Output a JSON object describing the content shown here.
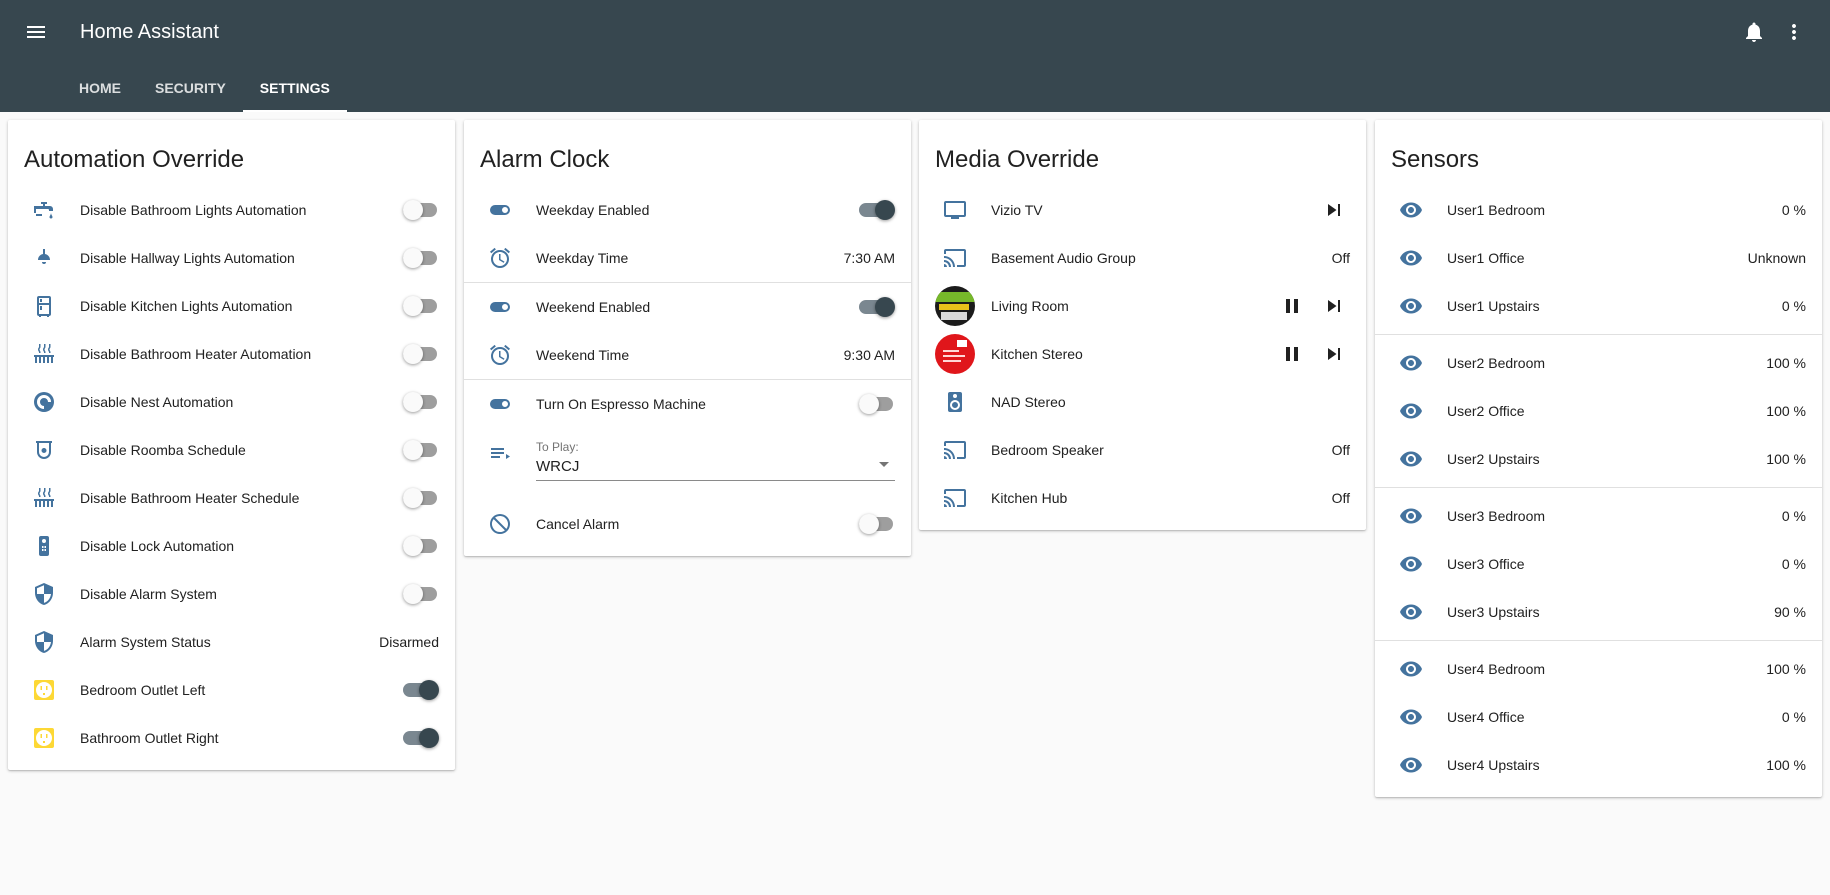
{
  "app": {
    "title": "Home Assistant",
    "tabs": [
      {
        "label": "HOME",
        "active": false
      },
      {
        "label": "SECURITY",
        "active": false
      },
      {
        "label": "SETTINGS",
        "active": true
      }
    ]
  },
  "colors": {
    "header": "#37474f",
    "icon": "#44739e",
    "icon_yellow": "#fdd835",
    "background": "#fafafa"
  },
  "automation": {
    "title": "Automation Override",
    "rows": [
      {
        "icon": "faucet-icon",
        "label": "Disable Bathroom Lights Automation",
        "on": false
      },
      {
        "icon": "ceiling-light-icon",
        "label": "Disable Hallway Lights Automation",
        "on": false
      },
      {
        "icon": "fridge-icon",
        "label": "Disable Kitchen Lights Automation",
        "on": false
      },
      {
        "icon": "radiator-icon",
        "label": "Disable Bathroom Heater Automation",
        "on": false
      },
      {
        "icon": "nest-thermostat-icon",
        "label": "Disable Nest Automation",
        "on": false
      },
      {
        "icon": "robot-vacuum-icon",
        "label": "Disable Roomba Schedule",
        "on": false
      },
      {
        "icon": "radiator-icon",
        "label": "Disable Bathroom Heater Schedule",
        "on": false
      },
      {
        "icon": "remote-icon",
        "label": "Disable Lock Automation",
        "on": false
      },
      {
        "icon": "security-shield-icon",
        "label": "Disable Alarm System",
        "on": false
      },
      {
        "icon": "security-shield-icon",
        "label": "Alarm System Status",
        "value": "Disarmed"
      },
      {
        "icon": "power-socket-icon",
        "label": "Bedroom Outlet Left",
        "on": true
      },
      {
        "icon": "power-socket-icon",
        "label": "Bathroom Outlet Right",
        "on": true
      }
    ]
  },
  "alarm": {
    "title": "Alarm Clock",
    "weekday_enabled": {
      "label": "Weekday Enabled",
      "on": true
    },
    "weekday_time": {
      "label": "Weekday Time",
      "value": "7:30 AM"
    },
    "weekend_enabled": {
      "label": "Weekend Enabled",
      "on": true
    },
    "weekend_time": {
      "label": "Weekend Time",
      "value": "9:30 AM"
    },
    "espresso": {
      "label": "Turn On Espresso Machine",
      "on": false
    },
    "to_play": {
      "label": "To Play:",
      "value": "WRCJ"
    },
    "cancel": {
      "label": "Cancel Alarm",
      "on": false
    }
  },
  "media": {
    "title": "Media Override",
    "rows": [
      {
        "icon": "television-icon",
        "label": "Vizio TV"
      },
      {
        "icon": "cast-icon",
        "label": "Basement Audio Group",
        "value": "Off"
      },
      {
        "icon": "album-art",
        "label": "Living Room"
      },
      {
        "icon": "album-art",
        "label": "Kitchen Stereo"
      },
      {
        "icon": "speaker-icon",
        "label": "NAD Stereo"
      },
      {
        "icon": "cast-icon",
        "label": "Bedroom Speaker",
        "value": "Off"
      },
      {
        "icon": "cast-icon",
        "label": "Kitchen Hub",
        "value": "Off"
      }
    ]
  },
  "sensors": {
    "title": "Sensors",
    "groups": [
      [
        {
          "label": "User1 Bedroom",
          "value": "0 %"
        },
        {
          "label": "User1 Office",
          "value": "Unknown"
        },
        {
          "label": "User1 Upstairs",
          "value": "0 %"
        }
      ],
      [
        {
          "label": "User2 Bedroom",
          "value": "100 %"
        },
        {
          "label": "User2 Office",
          "value": "100 %"
        },
        {
          "label": "User2 Upstairs",
          "value": "100 %"
        }
      ],
      [
        {
          "label": "User3 Bedroom",
          "value": "0 %"
        },
        {
          "label": "User3 Office",
          "value": "0 %"
        },
        {
          "label": "User3 Upstairs",
          "value": "90 %"
        }
      ],
      [
        {
          "label": "User4 Bedroom",
          "value": "100 %"
        },
        {
          "label": "User4 Office",
          "value": "0 %"
        },
        {
          "label": "User4 Upstairs",
          "value": "100 %"
        }
      ]
    ]
  }
}
